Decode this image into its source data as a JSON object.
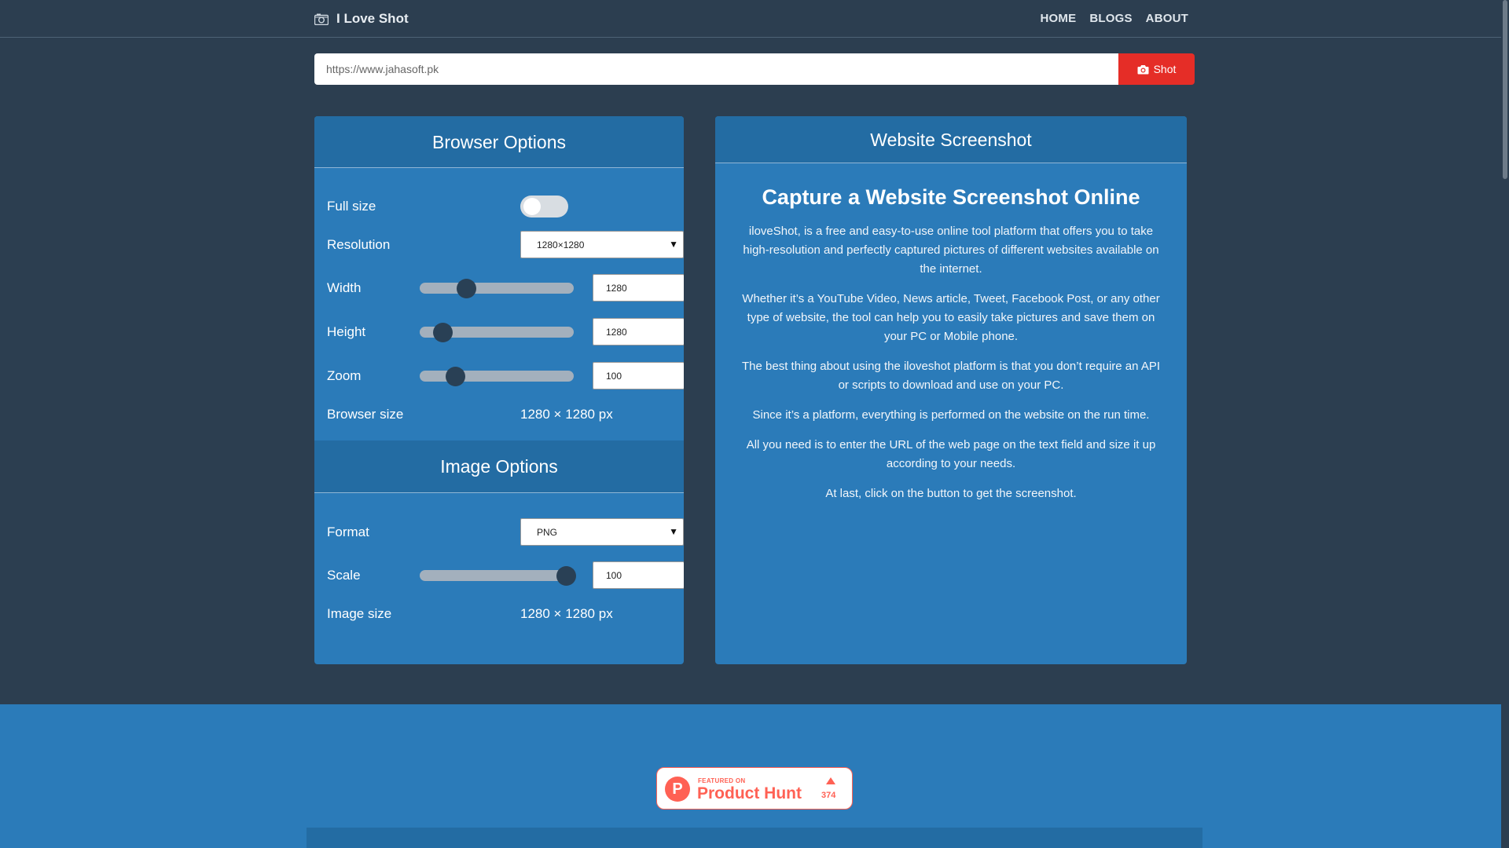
{
  "brand": {
    "title": "I Love Shot",
    "icon": "camera-icon"
  },
  "nav": {
    "items": [
      "HOME",
      "BLOGS",
      "ABOUT"
    ]
  },
  "urlbar": {
    "placeholder": "https://www.jahasoft.pk",
    "button_label": "Shot",
    "button_icon": "camera-icon"
  },
  "browser_options": {
    "title": "Browser Options",
    "full_size": {
      "label": "Full size",
      "enabled": false
    },
    "resolution": {
      "label": "Resolution",
      "value": "1280×1280"
    },
    "width": {
      "label": "Width",
      "value": "1280",
      "slider_fraction": 0.3
    },
    "height": {
      "label": "Height",
      "value": "1280",
      "slider_fraction": 0.15
    },
    "zoom": {
      "label": "Zoom",
      "value": "100",
      "slider_fraction": 0.23
    },
    "browser_size": {
      "label": "Browser size",
      "value": "1280 × 1280 px"
    }
  },
  "image_options": {
    "title": "Image Options",
    "format": {
      "label": "Format",
      "value": "PNG"
    },
    "scale": {
      "label": "Scale",
      "value": "100",
      "slider_fraction": 0.95
    },
    "image_size": {
      "label": "Image size",
      "value": "1280 × 1280 px"
    }
  },
  "website_screenshot": {
    "title": "Website Screenshot",
    "heading": "Capture a Website Screenshot Online",
    "paragraphs": [
      "iloveShot, is a free and easy-to-use online tool platform that offers you to take high-resolution and perfectly captured pictures of different websites available on the internet.",
      "Whether it’s a YouTube Video, News article, Tweet, Facebook Post, or any other type of website, the tool can help you to easily take pictures and save them on your PC or Mobile phone.",
      "The best thing about using the iloveshot platform is that you don’t require an API or scripts to download and use on your PC.",
      "Since it’s a platform, everything is performed on the website on the run time.",
      "All you need is to enter the URL of the web page on the text field and size it up according to your needs.",
      "At last, click on the button to get the screenshot."
    ]
  },
  "product_hunt": {
    "featured": "FEATURED ON",
    "name": "Product Hunt",
    "count": "374",
    "logo_letter": "P"
  },
  "colors": {
    "background": "#2c3e50",
    "panel": "#2b7bb9",
    "panel_header": "#236ca3",
    "shot_button": "#e52d27",
    "product_hunt": "#ff6154"
  }
}
